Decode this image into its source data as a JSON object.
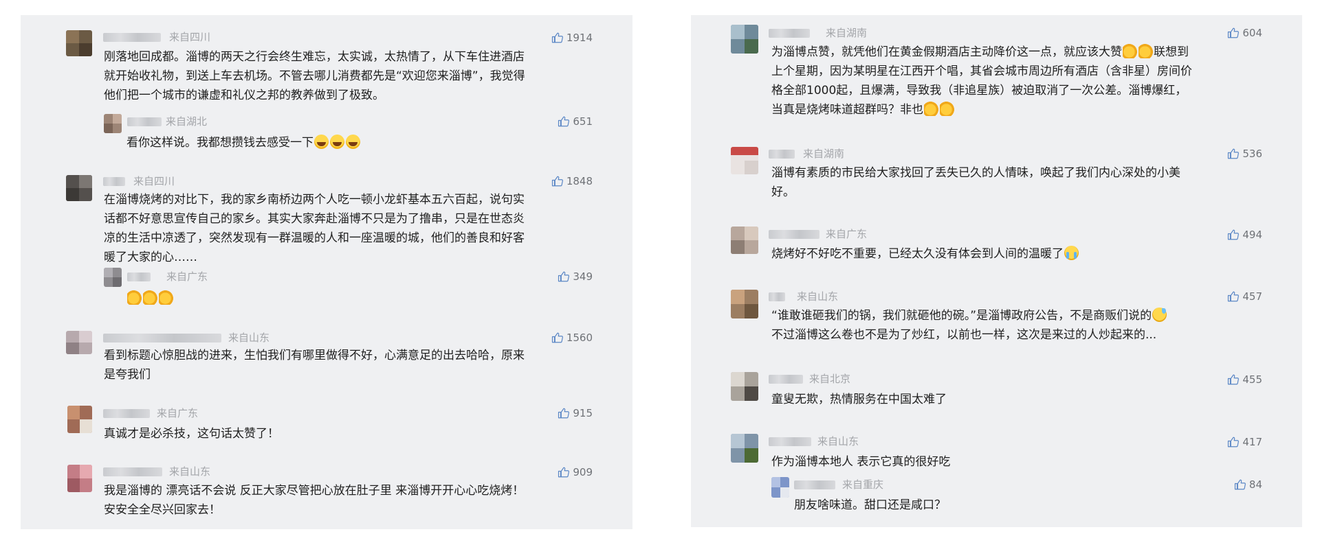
{
  "left_panel": {
    "comments": [
      {
        "location": "来自四川",
        "likes": "1914",
        "lines": [
          "刚落地回成都。淄博的两天之行会终生难忘，太实诚，太热情了，从下车住进酒店",
          "就开始收礼物，到送上车去机场。不管去哪儿消费都先是“欢迎您来淄博”，我觉得",
          "他们把一个城市的谦虚和礼仪之邦的教养做到了极致。"
        ],
        "reply": {
          "location": "来自湖北",
          "likes": "651",
          "text": "看你这样说。我都想攒钱去感受一下",
          "emoji": [
            "laugh-emoji",
            "laugh-emoji",
            "laugh-emoji"
          ]
        }
      },
      {
        "location": "来自四川",
        "likes": "1848",
        "lines": [
          "在淄博烧烤的对比下，我的家乡南桥边两个人吃一顿小龙虾基本五六百起，说句实",
          "话都不好意思宣传自己的家乡。其实大家奔赴淄博不只是为了撸串，只是在世态炎",
          "凉的生活中凉透了，突然发现有一群温暖的人和一座温暖的城，他们的善良和好客",
          "暖了大家的心……"
        ],
        "reply": {
          "location": "来自广东",
          "likes": "349",
          "text": "",
          "emoji": [
            "thumbs-up-emoji",
            "thumbs-up-emoji",
            "thumbs-up-emoji"
          ]
        }
      },
      {
        "location": "来自山东",
        "likes": "1560",
        "lines": [
          "看到标题心惊胆战的进来，生怕我们有哪里做得不好，心满意足的出去哈哈，原来",
          "是夸我们"
        ]
      },
      {
        "location": "来自广东",
        "likes": "915",
        "lines": [
          "真诚才是必杀技，这句话太赞了！"
        ]
      },
      {
        "location": "来自山东",
        "likes": "909",
        "lines": [
          "我是淄博的 漂亮话不会说 反正大家尽管把心放在肚子里 来淄博开开心心吃烧烤！",
          "安安全全尽兴回家去！"
        ]
      }
    ]
  },
  "right_panel": {
    "comments": [
      {
        "location": "来自湖南",
        "likes": "604",
        "line1": "为淄博点赞，就凭他们在黄金假期酒店主动降价这一点，就应该大赞",
        "line1_emoji": [
          "thumbs-up-emoji",
          "thumbs-up-emoji"
        ],
        "line1_tail": "联想到",
        "lines_mid": [
          "上个星期，因为某明星在江西开个唱，其省会城市周边所有酒店（含非星）房间价",
          "格全部1000起，且爆满，导致我（非追星族）被迫取消了一次公差。淄博爆红，"
        ],
        "last_line": "当真是烧烤味道超群吗？非也",
        "last_emoji": [
          "thumbs-up-emoji",
          "thumbs-up-emoji"
        ]
      },
      {
        "location": "来自湖南",
        "likes": "536",
        "lines": [
          "淄博有素质的市民给大家找回了丢失已久的人情味，唤起了我们内心深处的小美",
          "好。"
        ]
      },
      {
        "location": "来自广东",
        "likes": "494",
        "text": "烧烤好不好吃不重要，已经太久没有体会到人间的温暖了",
        "emoji": [
          "crying-emoji"
        ]
      },
      {
        "location": "来自山东",
        "likes": "457",
        "line1": "“谁敢谁砸我们的锅，我们就砸他的碗。”是淄博政府公告，不是商贩们说的",
        "line1_emoji": [
          "sweat-emoji"
        ],
        "line2": "不过淄博这么卷也不是为了炒红，以前也一样，这次是来过的人炒起来的..."
      },
      {
        "location": "来自北京",
        "likes": "455",
        "lines": [
          "童叟无欺，热情服务在中国太难了"
        ]
      },
      {
        "location": "来自山东",
        "likes": "417",
        "lines": [
          "作为淄博本地人 表示它真的很好吃"
        ],
        "reply": {
          "location": "来自重庆",
          "likes": "84",
          "text": "朋友啥味道。甜口还是咸口？"
        }
      }
    ]
  },
  "colors": {
    "panel_background": "#eff0f2",
    "text": "#1f1f1f",
    "location_text": "#a3a5a9",
    "likes_text": "#6f7277"
  },
  "icons": {
    "likes": "thumbs-up-icon",
    "avatar": "blurred-avatar-image"
  }
}
